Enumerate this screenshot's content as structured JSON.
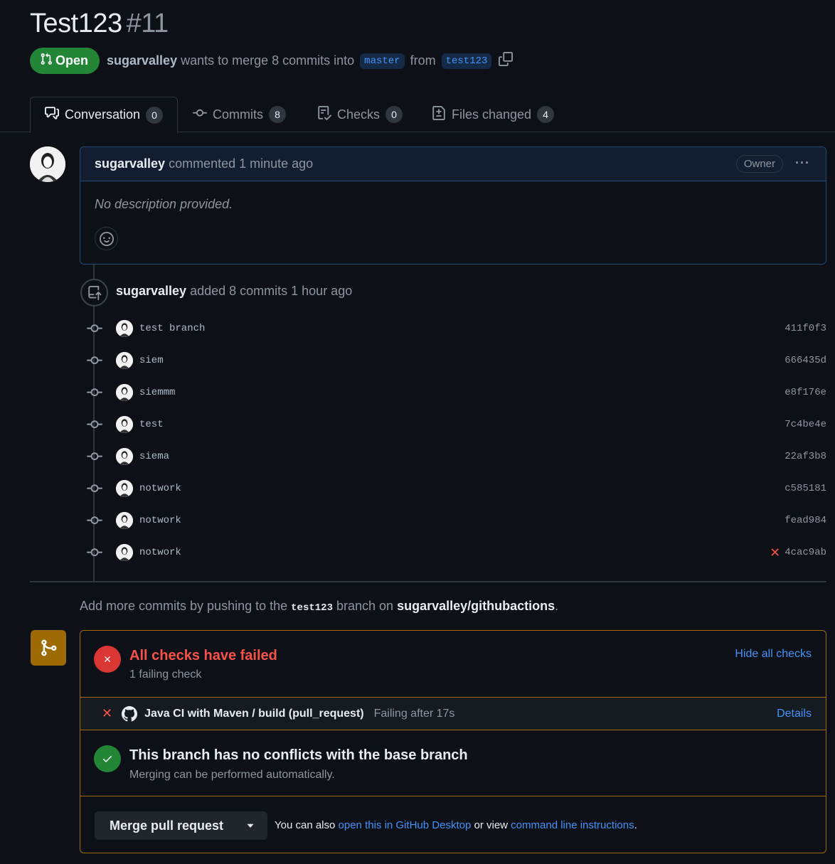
{
  "pr": {
    "title": "Test123",
    "number": "#11",
    "state": "Open",
    "author": "sugarvalley",
    "summary": "wants to merge 8 commits into",
    "base_branch": "master",
    "from_word": "from",
    "head_branch": "test123"
  },
  "tabs": [
    {
      "label": "Conversation",
      "count": "0"
    },
    {
      "label": "Commits",
      "count": "8"
    },
    {
      "label": "Checks",
      "count": "0"
    },
    {
      "label": "Files changed",
      "count": "4"
    }
  ],
  "comment": {
    "author": "sugarvalley",
    "action": "commented",
    "time": "1 minute ago",
    "badge": "Owner",
    "body": "No description provided."
  },
  "event": {
    "author": "sugarvalley",
    "text": "added 8 commits 1 hour ago"
  },
  "commits": [
    {
      "message": "test branch",
      "sha": "411f0f3",
      "failed": false
    },
    {
      "message": "siem",
      "sha": "666435d",
      "failed": false
    },
    {
      "message": "siemmm",
      "sha": "e8f176e",
      "failed": false
    },
    {
      "message": "test",
      "sha": "7c4be4e",
      "failed": false
    },
    {
      "message": "siema",
      "sha": "22af3b8",
      "failed": false
    },
    {
      "message": "notwork",
      "sha": "c585181",
      "failed": false
    },
    {
      "message": "notwork",
      "sha": "fead984",
      "failed": false
    },
    {
      "message": "notwork",
      "sha": "4cac9ab",
      "failed": true
    }
  ],
  "hint": {
    "prefix": "Add more commits by pushing to the",
    "branch": "test123",
    "middle": "branch on",
    "repo": "sugarvalley/githubactions",
    "suffix": "."
  },
  "checks": {
    "title": "All checks have failed",
    "subtitle": "1 failing check",
    "hide_label": "Hide all checks",
    "item_name": "Java CI with Maven / build (pull_request)",
    "item_status": "Failing after 17s",
    "details_label": "Details"
  },
  "conflicts": {
    "title": "This branch has no conflicts with the base branch",
    "subtitle": "Merging can be performed automatically."
  },
  "merge": {
    "button_label": "Merge pull request",
    "note_prefix": "You can also",
    "desktop_link": "open this in GitHub Desktop",
    "note_middle": "or view",
    "cli_link": "command line instructions",
    "note_suffix": "."
  },
  "colors": {
    "open_green": "#238636",
    "fail_red": "#f85149",
    "warn_border": "#9e6a03",
    "link_blue": "#4493f8"
  }
}
